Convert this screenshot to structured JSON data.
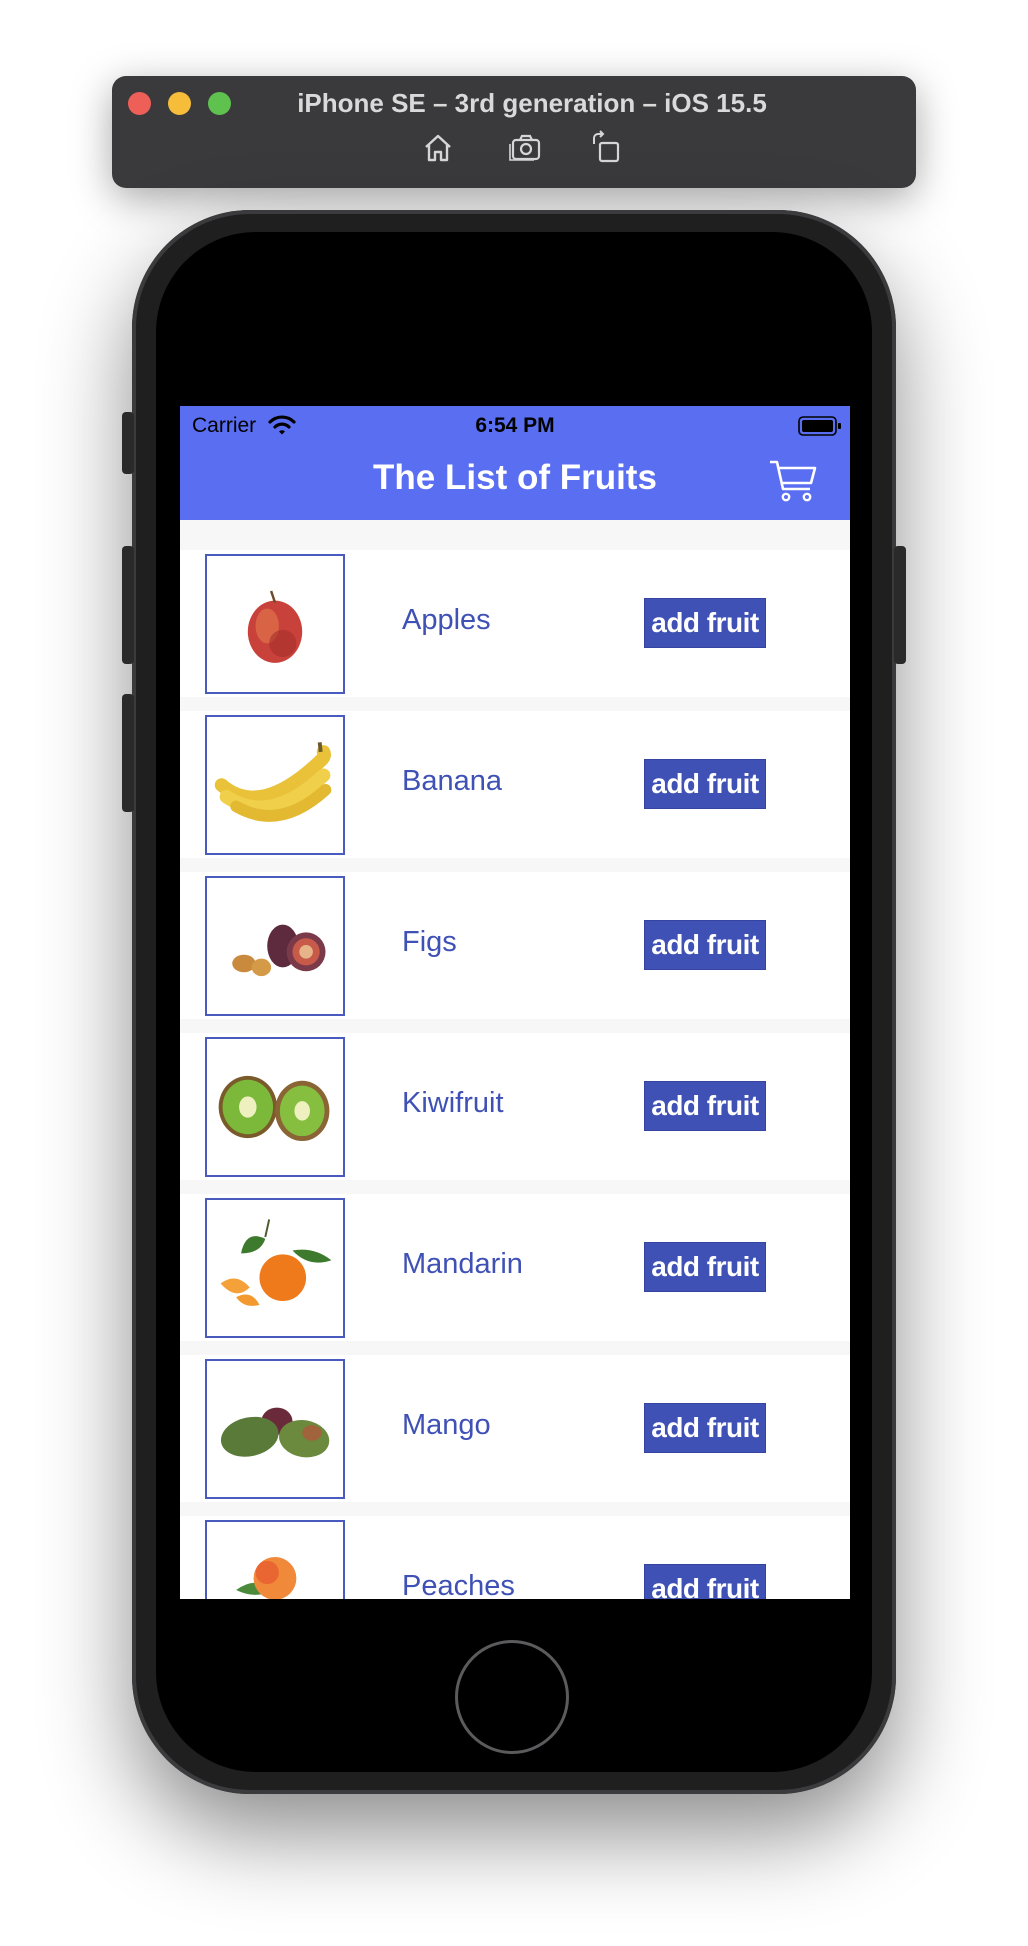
{
  "simulator": {
    "title": "iPhone SE – 3rd generation – iOS 15.5",
    "controls": [
      "home-icon",
      "screenshot-icon",
      "rotate-icon"
    ]
  },
  "status_bar": {
    "carrier": "Carrier",
    "time": "6:54 PM"
  },
  "header": {
    "title": "The List of Fruits",
    "cart_icon": "cart-icon"
  },
  "colors": {
    "header_bg": "#5a6ef2",
    "accent": "#3f51b5",
    "list_bg": "#f7f7f7"
  },
  "fruits": [
    {
      "name": "Apples",
      "button": "add fruit"
    },
    {
      "name": "Banana",
      "button": "add fruit"
    },
    {
      "name": "Figs",
      "button": "add fruit"
    },
    {
      "name": "Kiwifruit",
      "button": "add fruit"
    },
    {
      "name": "Mandarin",
      "button": "add fruit"
    },
    {
      "name": "Mango",
      "button": "add fruit"
    },
    {
      "name": "Peaches",
      "button": "add fruit"
    }
  ]
}
